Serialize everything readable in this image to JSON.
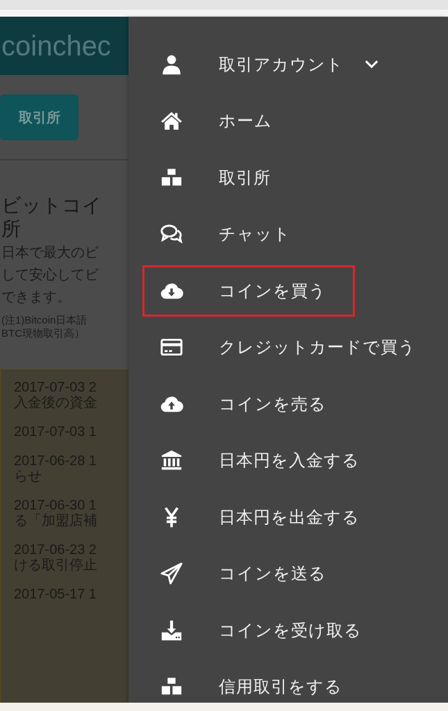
{
  "page": {
    "logo": "coinchec",
    "exchange_button": "取引所",
    "heading": [
      "ビットコイ",
      "所"
    ],
    "intro": [
      "日本で最大のビ",
      "して安心してビ",
      "できます。"
    ],
    "note": [
      "(注1)Bitcoin日本語",
      "BTC現物取引高）"
    ],
    "news": [
      [
        "2017-07-03 2",
        "入金後の資金"
      ],
      [
        "2017-07-03 1"
      ],
      [
        "2017-06-28 1",
        "らせ"
      ],
      [
        "2017-06-30 1",
        "る「加盟店補"
      ],
      [
        "2017-06-23 2",
        "ける取引停止"
      ],
      [
        "2017-05-17 1"
      ]
    ]
  },
  "menu": {
    "items": [
      {
        "label": "取引アカウント",
        "expanded": false,
        "highlighted": false
      },
      {
        "label": "ホーム",
        "highlighted": false
      },
      {
        "label": "取引所",
        "highlighted": false
      },
      {
        "label": "チャット",
        "highlighted": false
      },
      {
        "label": "コインを買う",
        "highlighted": true
      },
      {
        "label": "クレジットカードで買う",
        "highlighted": false
      },
      {
        "label": "コインを売る",
        "highlighted": false
      },
      {
        "label": "日本円を入金する",
        "highlighted": false
      },
      {
        "label": "日本円を出金する",
        "highlighted": false
      },
      {
        "label": "コインを送る",
        "highlighted": false
      },
      {
        "label": "コインを受け取る",
        "highlighted": false
      },
      {
        "label": "信用取引をする",
        "highlighted": false
      }
    ]
  }
}
